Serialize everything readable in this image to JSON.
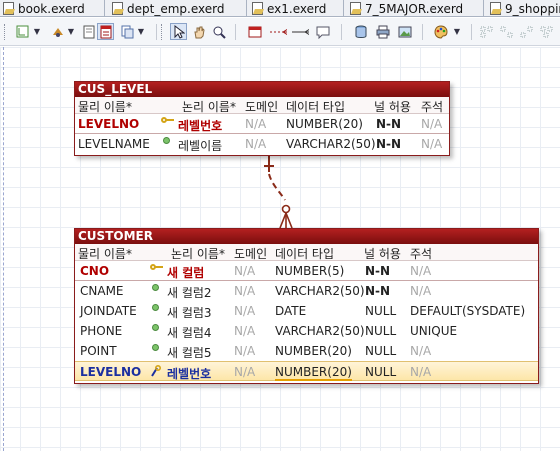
{
  "tabs": [
    "book.exerd",
    "dept_emp.exerd",
    "ex1.exerd",
    "7_5MAJOR.exerd",
    "9_shoppin"
  ],
  "toolbar": {
    "icons": [
      "layout-icon",
      "shape-icon",
      "note-icon",
      "table-icon",
      "select-icon",
      "hand-icon",
      "zoom-icon",
      "entity-icon",
      "identifying-relation-icon",
      "non-identifying-relation-icon",
      "comment-icon",
      "db-icon",
      "print-icon",
      "image-icon",
      "palette-icon"
    ]
  },
  "headers": {
    "physical": "물리 이름*",
    "logical": "논리 이름*",
    "domain": "도메인",
    "datatype": "데이터 타입",
    "nullable": "널 허용",
    "comment": "주석"
  },
  "cus_level": {
    "title": "CUS_LEVEL",
    "rows": [
      {
        "physical": "LEVELNO",
        "logical": "레벨번호",
        "domain": "N/A",
        "datatype": "NUMBER(20)",
        "nullable": "N-N",
        "comment": "N/A"
      },
      {
        "physical": "LEVELNAME",
        "logical": "레벨이름",
        "domain": "N/A",
        "datatype": "VARCHAR2(50)",
        "nullable": "N-N",
        "comment": "N/A"
      }
    ]
  },
  "customer": {
    "title": "CUSTOMER",
    "rows": [
      {
        "physical": "CNO",
        "logical": "새 컬럼",
        "domain": "N/A",
        "datatype": "NUMBER(5)",
        "nullable": "N-N",
        "comment": "N/A"
      },
      {
        "physical": "CNAME",
        "logical": "새 컬럼2",
        "domain": "N/A",
        "datatype": "VARCHAR2(50)",
        "nullable": "N-N",
        "comment": "N/A"
      },
      {
        "physical": "JOINDATE",
        "logical": "새 컬럼3",
        "domain": "N/A",
        "datatype": "DATE",
        "nullable": "NULL",
        "comment": "DEFAULT(SYSDATE)"
      },
      {
        "physical": "PHONE",
        "logical": "새 컬럼4",
        "domain": "N/A",
        "datatype": "VARCHAR2(50)",
        "nullable": "NULL",
        "comment": "UNIQUE"
      },
      {
        "physical": "POINT",
        "logical": "새 컬럼5",
        "domain": "N/A",
        "datatype": "NUMBER(20)",
        "nullable": "NULL",
        "comment": "N/A"
      },
      {
        "physical": "LEVELNO",
        "logical": "레벨번호",
        "domain": "N/A",
        "datatype": "NUMBER(20)",
        "nullable": "NULL",
        "comment": "N/A"
      }
    ]
  },
  "colors": {
    "pk": "#b00000",
    "fk": "#1b2fa0",
    "relation": "#8a2a18"
  }
}
